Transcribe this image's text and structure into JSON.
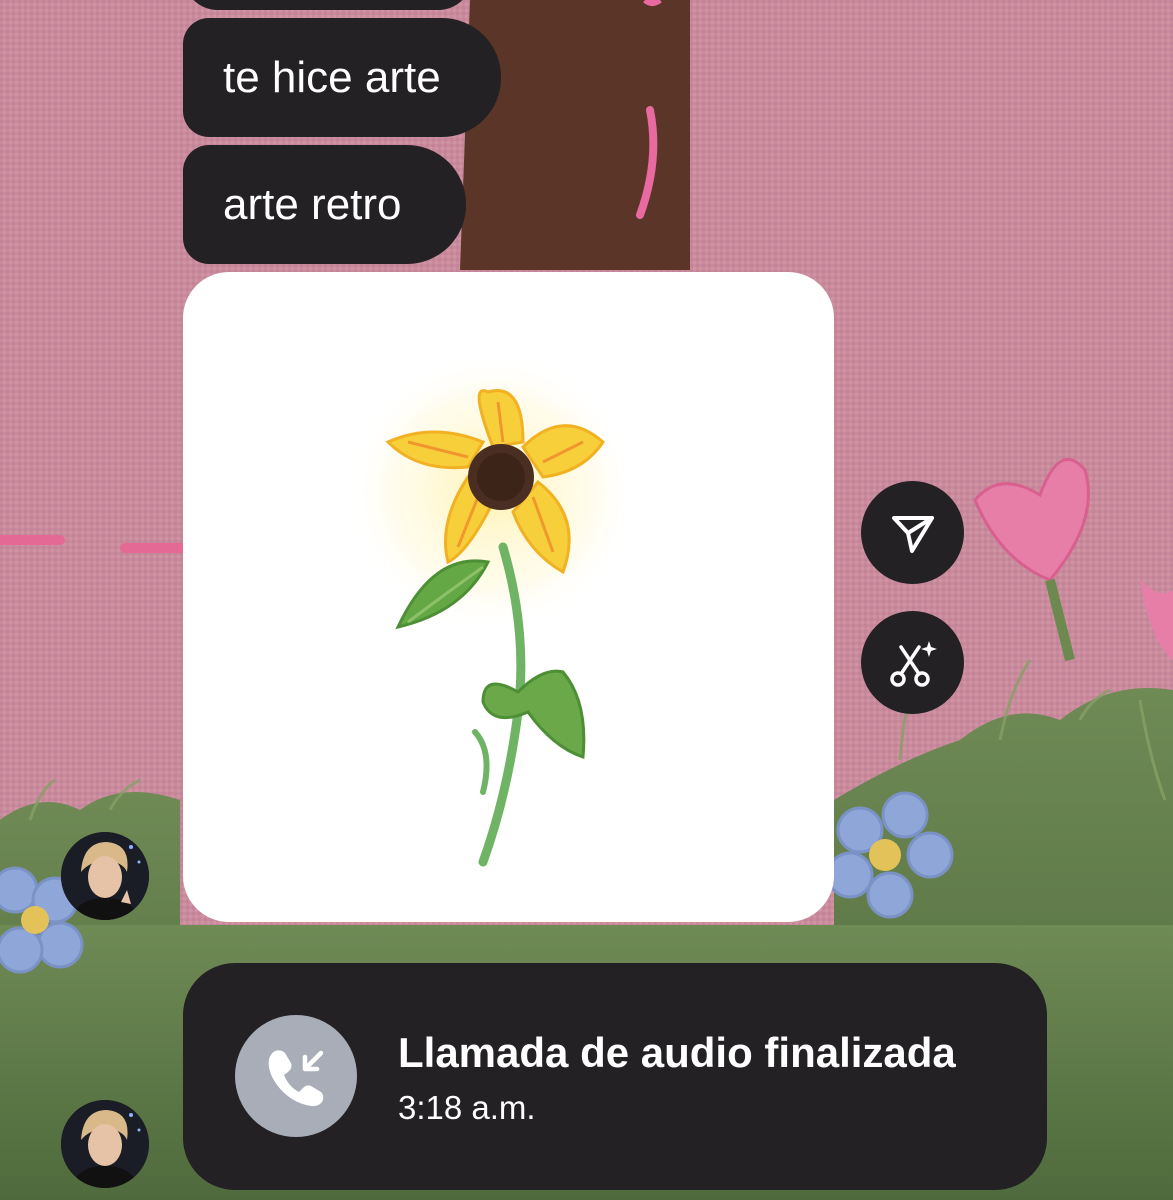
{
  "messages": [
    {
      "text": "te hice arte"
    },
    {
      "text": "arte retro"
    }
  ],
  "image_message": {
    "subject": "sunflower drawing",
    "actions": [
      {
        "icon": "send-icon"
      },
      {
        "icon": "remix-icon"
      }
    ]
  },
  "call": {
    "title": "Llamada de audio finalizada",
    "time": "3:18 a.m.",
    "icon": "incoming-call-icon"
  },
  "avatars": [
    {
      "icon": "avatar"
    },
    {
      "icon": "avatar"
    }
  ],
  "colors": {
    "bubble": "#232124",
    "wallpaper": "#c98a9c",
    "grass": "#5f7a45",
    "call_icon_bg": "#a9adb8"
  }
}
